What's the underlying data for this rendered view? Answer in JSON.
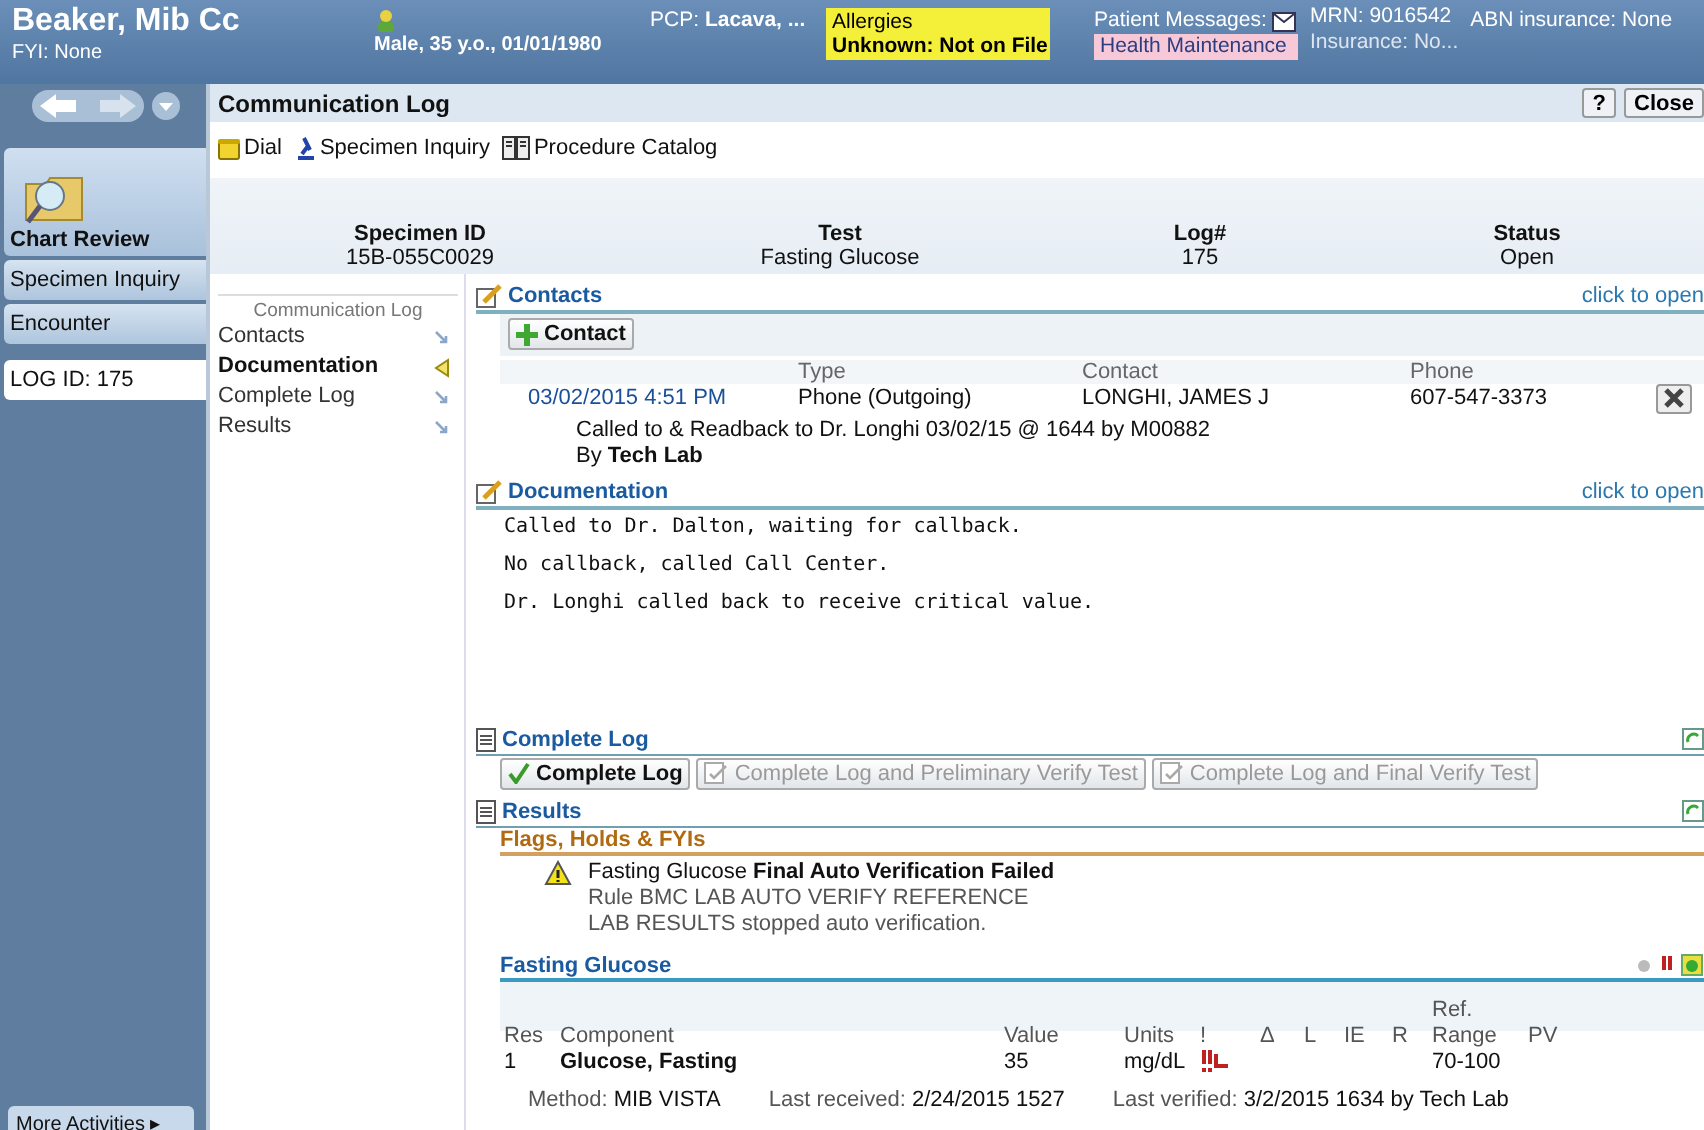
{
  "header": {
    "name": "Beaker, Mib Cc",
    "fyi": "FYI: None",
    "demographics": "Male, 35 y.o., 01/01/1980",
    "pcp_label": "PCP:",
    "pcp_value": "Lacava, ...",
    "allergies_title": "Allergies",
    "allergies_value": "Unknown: Not on File",
    "messages": "Patient Messages:",
    "health_maintenance": "Health Maintenance",
    "mrn": "MRN: 9016542",
    "insurance": "Insurance: No...",
    "abn": "ABN insurance: None"
  },
  "activity": {
    "title": "Communication Log",
    "help": "?",
    "close": "Close"
  },
  "toolbar": [
    "Dial",
    "Specimen Inquiry",
    "Procedure Catalog"
  ],
  "sidebar": {
    "chart_review": "Chart Review",
    "tabs": [
      {
        "label": "Specimen Inquiry",
        "selected": false
      },
      {
        "label": "Encounter",
        "selected": false
      },
      {
        "label": "LOG ID: 175",
        "selected": true
      }
    ],
    "more": "More Activities ▸"
  },
  "summary": [
    {
      "label": "Specimen ID",
      "value": "15B-055C0029"
    },
    {
      "label": "Test",
      "value": "Fasting Glucose"
    },
    {
      "label": "Log#",
      "value": "175"
    },
    {
      "label": "Status",
      "value": "Open"
    }
  ],
  "nav": {
    "title": "Communication Log",
    "items": [
      {
        "label": "Contacts",
        "selected": false
      },
      {
        "label": "Documentation",
        "selected": true
      },
      {
        "label": "Complete Log",
        "selected": false
      },
      {
        "label": "Results",
        "selected": false
      }
    ]
  },
  "contacts": {
    "title": "Contacts",
    "link": "click to open",
    "add": "Contact",
    "columns": [
      "Type",
      "Contact",
      "Phone"
    ],
    "entry": {
      "date": "03/02/2015 4:51 PM",
      "type": "Phone (Outgoing)",
      "contact": "LONGHI, JAMES J",
      "phone": "607-547-3373",
      "note": "Called to & Readback to Dr. Longhi 03/02/15 @ 1644 by M00882",
      "by": "By **Tech Lab**"
    }
  },
  "documentation": {
    "title": "Documentation",
    "link": "click to open",
    "lines": [
      "Called to Dr. Dalton, waiting for callback.",
      "No callback, called Call Center.",
      "Dr. Longhi called back to receive critical value."
    ]
  },
  "complete_log": {
    "title": "Complete Log",
    "buttons": [
      {
        "label": "Complete Log",
        "disabled": false
      },
      {
        "label": "Complete Log and Preliminary Verify Test",
        "disabled": true
      },
      {
        "label": "Complete Log and Final Verify Test",
        "disabled": true
      }
    ]
  },
  "results": {
    "title": "Results",
    "flags_title": "Flags, Holds & FYIs",
    "flag": "Fasting Glucose **Final Auto Verification Failed**",
    "rule": [
      "Rule BMC LAB AUTO VERIFY REFERENCE",
      "LAB RESULTS stopped auto verification."
    ],
    "test": "Fasting Glucose",
    "columns": [
      "Res",
      "Component",
      "Value",
      "Units",
      "!",
      "Δ",
      "L",
      "IE",
      "R",
      "Ref. Range",
      "PV"
    ],
    "row": {
      "res": "1",
      "component": "Glucose, Fasting",
      "value": "35",
      "units": "mg/dL",
      "critical": true,
      "range": "70-100"
    },
    "method": "Method: **MIB VISTA**",
    "received": "Last received: **2/24/2015 1527**",
    "verified": "Last verified: **3/2/2015 1634 by Tech Lab**"
  }
}
